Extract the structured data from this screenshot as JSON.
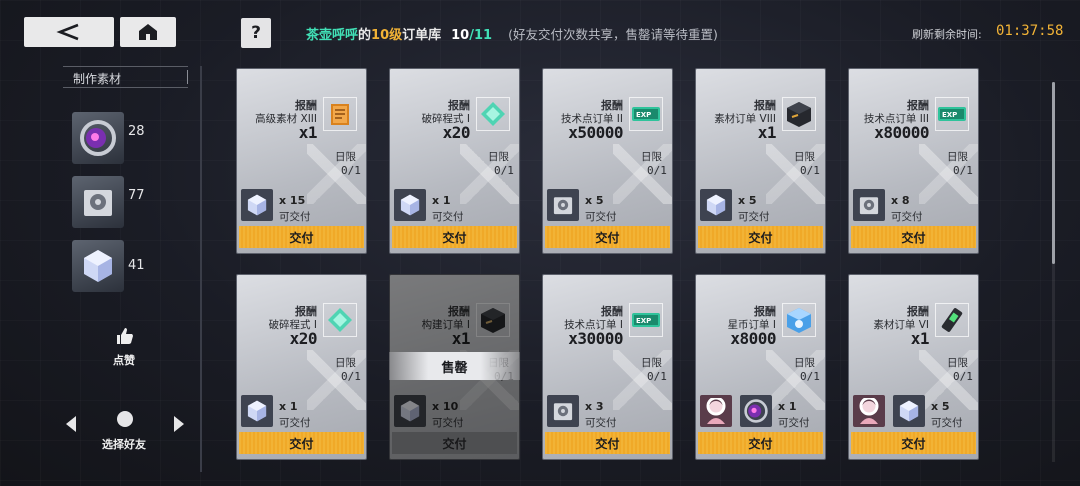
{
  "header": {
    "friend_name": "茶壶呼呼",
    "de": "的",
    "level": "10级",
    "library": "订单库",
    "count_current": "10",
    "count_sep": "/",
    "count_max": "11",
    "note": "(好友交付次数共享，售罄请等待重置)",
    "refresh_label": "刷新剩余时间:",
    "refresh_time": "01:37:58",
    "help_label": "?"
  },
  "sidebar": {
    "title": "制作素材",
    "materials": [
      {
        "count": "28",
        "icon": "purple-orb-icon"
      },
      {
        "count": "77",
        "icon": "disk-icon"
      },
      {
        "count": "41",
        "icon": "crystal-cube-icon"
      }
    ],
    "like_label": "点赞",
    "select_friend_label": "选择好友"
  },
  "cards": [
    {
      "reward_head": "报酬",
      "reward_name": "高级素材 XIII",
      "reward_qty": "x1",
      "reward_icon": "orange-box-icon",
      "limit_label": "日限",
      "limit_val": "0/1",
      "req_qty": "x 15",
      "req_avail": "可交付",
      "req_icon": "crystal-cube-icon",
      "button": "交付"
    },
    {
      "reward_head": "报酬",
      "reward_name": "破碎程式 I",
      "reward_qty": "x20",
      "reward_icon": "green-shard-icon",
      "limit_label": "日限",
      "limit_val": "0/1",
      "req_qty": "x 1",
      "req_avail": "可交付",
      "req_icon": "crystal-cube-icon",
      "button": "交付"
    },
    {
      "reward_head": "报酬",
      "reward_name": "技术点订单 II",
      "reward_qty": "x50000",
      "reward_icon": "exp-ticket-icon",
      "limit_label": "日限",
      "limit_val": "0/1",
      "req_qty": "x 5",
      "req_avail": "可交付",
      "req_icon": "disk-icon",
      "button": "交付"
    },
    {
      "reward_head": "报酬",
      "reward_name": "素材订单 VIII",
      "reward_qty": "x1",
      "reward_icon": "dark-box-icon",
      "limit_label": "日限",
      "limit_val": "0/1",
      "req_qty": "x 5",
      "req_avail": "可交付",
      "req_icon": "crystal-cube-icon",
      "button": "交付"
    },
    {
      "reward_head": "报酬",
      "reward_name": "技术点订单 III",
      "reward_qty": "x80000",
      "reward_icon": "exp-ticket-icon",
      "limit_label": "日限",
      "limit_val": "0/1",
      "req_qty": "x 8",
      "req_avail": "可交付",
      "req_icon": "disk-icon",
      "button": "交付"
    },
    {
      "reward_head": "报酬",
      "reward_name": "破碎程式 I",
      "reward_qty": "x20",
      "reward_icon": "green-shard-icon",
      "limit_label": "日限",
      "limit_val": "0/1",
      "req_qty": "x 1",
      "req_avail": "可交付",
      "req_icon": "crystal-cube-icon",
      "button": "交付"
    },
    {
      "reward_head": "报酬",
      "reward_name": "构建订单 I",
      "reward_qty": "x1",
      "reward_icon": "dark-box-icon",
      "limit_label": "日限",
      "limit_val": "0/1",
      "req_qty": "x 10",
      "req_avail": "可交付",
      "req_icon": "crystal-cube-icon",
      "button": "交付",
      "soldout": "售罄"
    },
    {
      "reward_head": "报酬",
      "reward_name": "技术点订单 I",
      "reward_qty": "x30000",
      "reward_icon": "exp-ticket-icon",
      "limit_label": "日限",
      "limit_val": "0/1",
      "req_qty": "x 3",
      "req_avail": "可交付",
      "req_icon": "disk-icon",
      "button": "交付"
    },
    {
      "reward_head": "报酬",
      "reward_name": "星币订单 I",
      "reward_qty": "x8000",
      "reward_icon": "blue-coin-box-icon",
      "limit_label": "日限",
      "limit_val": "0/1",
      "req_qty": "x 1",
      "req_avail": "可交付",
      "req_icon": "purple-orb-icon",
      "button": "交付"
    },
    {
      "reward_head": "报酬",
      "reward_name": "素材订单 VI",
      "reward_qty": "x1",
      "reward_icon": "green-cartridge-icon",
      "limit_label": "日限",
      "limit_val": "0/1",
      "req_qty": "x 5",
      "req_avail": "可交付",
      "req_icon": "crystal-cube-icon",
      "button": "交付"
    }
  ]
}
